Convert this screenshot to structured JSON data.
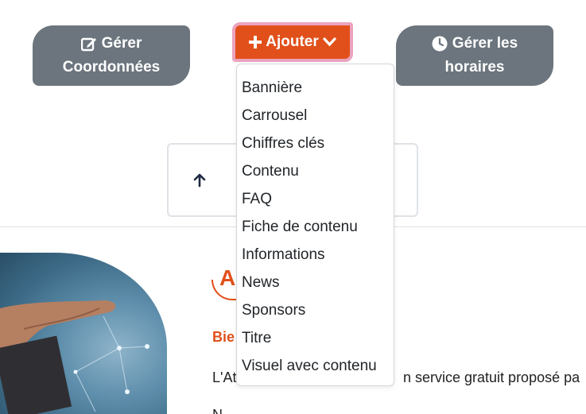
{
  "buttons": {
    "manage_contacts": {
      "line1": "Gérer",
      "line2": "Coordonnées",
      "icon": "edit-icon"
    },
    "add": {
      "label": "Ajouter",
      "icon": "plus-icon",
      "caret_icon": "chevron-down-icon"
    },
    "manage_hours": {
      "line1": "Gérer les",
      "line2": "horaires",
      "icon": "clock-icon"
    }
  },
  "dropdown": {
    "items": [
      "Bannière",
      "Carrousel",
      "Chiffres clés",
      "Contenu",
      "FAQ",
      "Fiche de contenu",
      "Informations",
      "News",
      "Sponsors",
      "Titre",
      "Visuel avec contenu"
    ]
  },
  "content": {
    "logo_letter": "A",
    "welcome": "Bie",
    "paragraph1_start": "L'At",
    "paragraph1_end": "n service gratuit proposé pa",
    "paragraph2": "N"
  },
  "colors": {
    "accent": "#e1501a",
    "gray_button": "#6c757d",
    "focus_ring": "#eba3be"
  }
}
